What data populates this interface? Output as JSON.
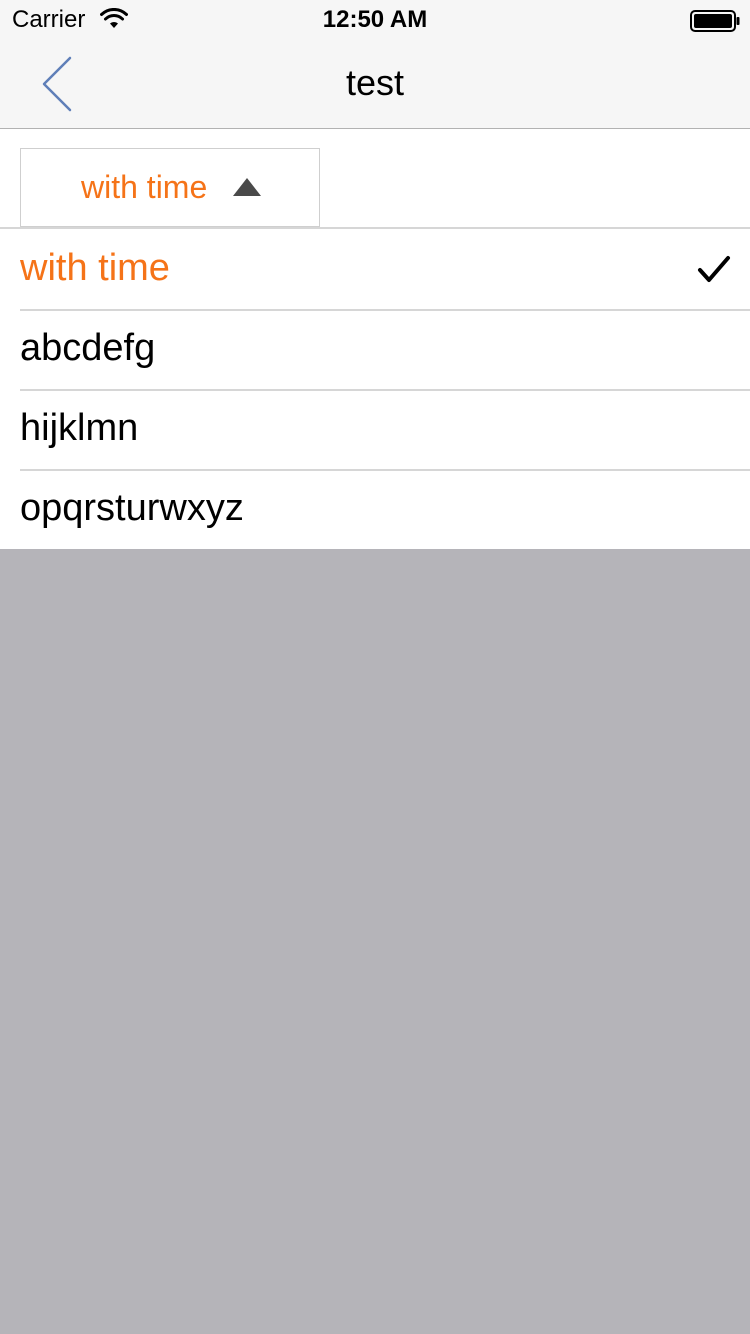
{
  "status_bar": {
    "carrier": "Carrier",
    "time": "12:50 AM",
    "wifi_icon": "wifi-icon",
    "battery_icon": "battery-icon",
    "battery_level": 1.0
  },
  "nav_bar": {
    "title": "test",
    "back_icon": "chevron-left-icon",
    "back_icon_color": "#5f7fb8"
  },
  "filter": {
    "label": "with time",
    "caret_icon": "caret-up-icon",
    "accent_color": "#f57318"
  },
  "options": [
    {
      "label": "with time",
      "selected": true
    },
    {
      "label": "abcdefg",
      "selected": false
    },
    {
      "label": "hijklmn",
      "selected": false
    },
    {
      "label": "opqrsturwxyz",
      "selected": false
    }
  ],
  "overlay_color": "#b5b4b9"
}
